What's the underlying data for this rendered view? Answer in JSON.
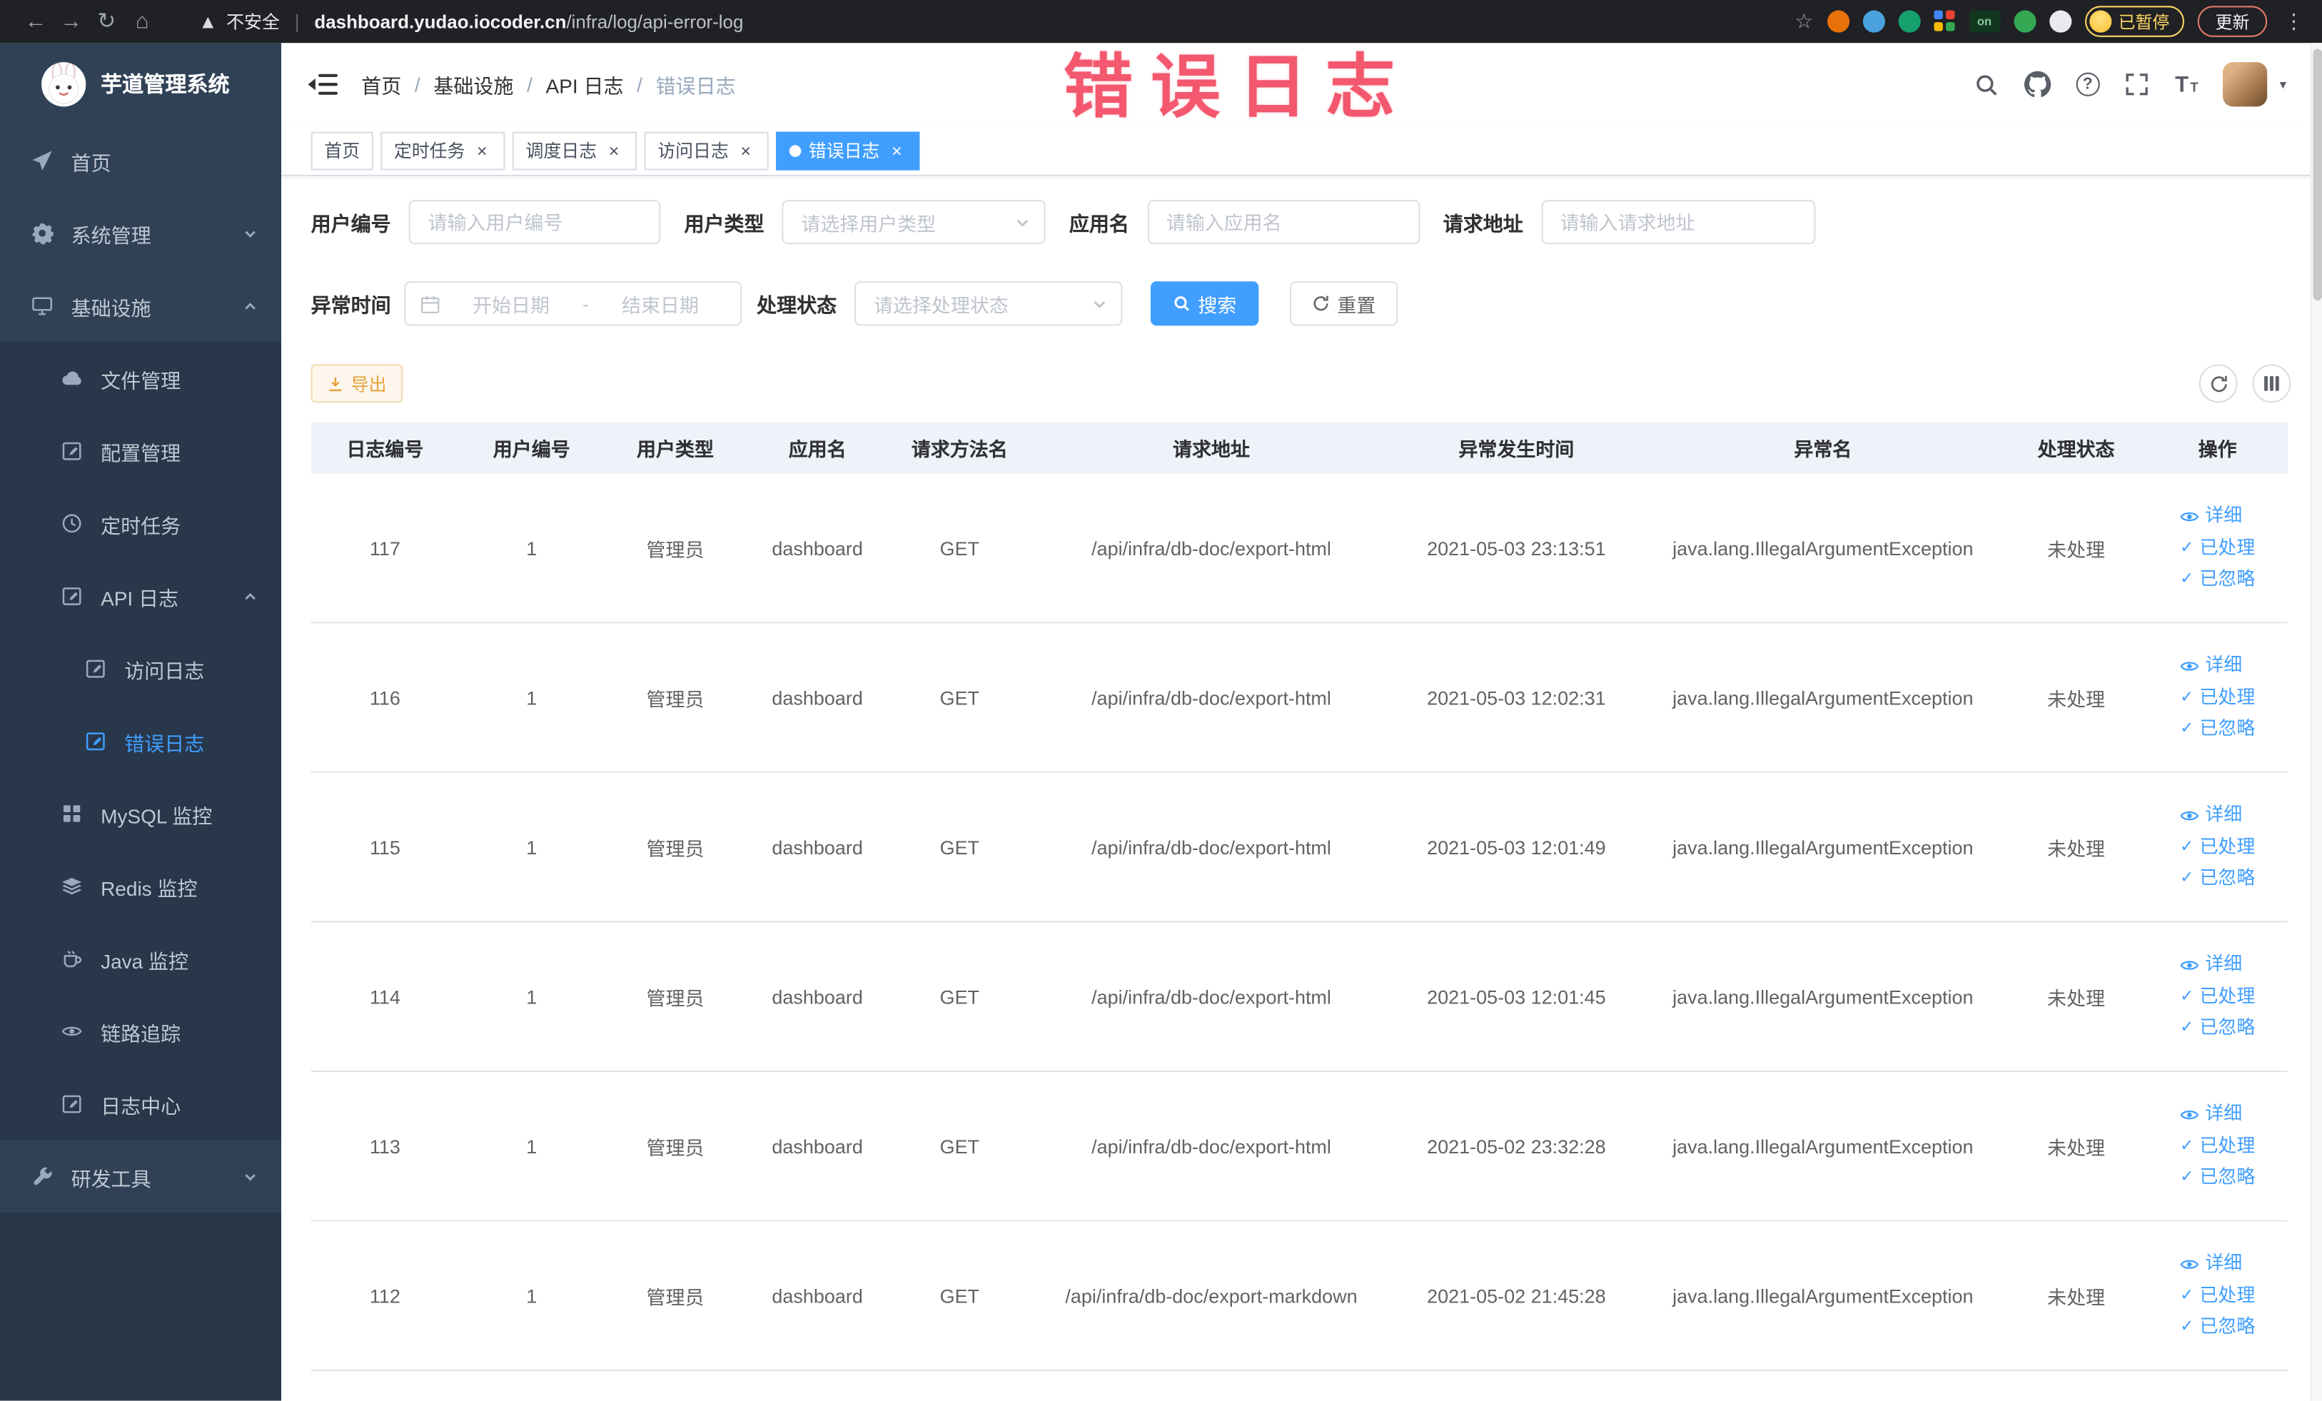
{
  "annotation": {
    "text": "错误日志"
  },
  "browser": {
    "security_label": "不安全",
    "url_domain": "dashboard.yudao.iocoder.cn",
    "url_path": "/infra/log/api-error-log",
    "extension_on_badge": "on",
    "paused_badge": "已暂停",
    "update_button": "更新"
  },
  "sidebar": {
    "logo_title": "芋道管理系统",
    "items": {
      "home": "首页",
      "system": "系统管理",
      "infra": "基础设施",
      "file": "文件管理",
      "config": "配置管理",
      "job": "定时任务",
      "apilog": "API 日志",
      "accesslog": "访问日志",
      "errorlog": "错误日志",
      "mysql": "MySQL 监控",
      "redis": "Redis 监控",
      "java": "Java 监控",
      "trace": "链路追踪",
      "logcenter": "日志中心",
      "devtools": "研发工具"
    }
  },
  "header": {
    "breadcrumb": [
      "首页",
      "基础设施",
      "API 日志",
      "错误日志"
    ]
  },
  "tabs": {
    "home": "首页",
    "job": "定时任务",
    "joblog": "调度日志",
    "accesslog": "访问日志",
    "errorlog": "错误日志"
  },
  "filters": {
    "user_id": {
      "label": "用户编号",
      "placeholder": "请输入用户编号"
    },
    "user_type": {
      "label": "用户类型",
      "placeholder": "请选择用户类型"
    },
    "app_name": {
      "label": "应用名",
      "placeholder": "请输入应用名"
    },
    "request_url": {
      "label": "请求地址",
      "placeholder": "请输入请求地址"
    },
    "exception_time": {
      "label": "异常时间",
      "start_placeholder": "开始日期",
      "separator": "-",
      "end_placeholder": "结束日期"
    },
    "process_status": {
      "label": "处理状态",
      "placeholder": "请选择处理状态"
    },
    "search_button": "搜索",
    "reset_button": "重置"
  },
  "toolbar": {
    "export_button": "导出"
  },
  "table": {
    "columns": [
      "日志编号",
      "用户编号",
      "用户类型",
      "应用名",
      "请求方法名",
      "请求地址",
      "异常发生时间",
      "异常名",
      "处理状态",
      "操作"
    ],
    "actions": {
      "detail": "详细",
      "processed": "已处理",
      "ignored": "已忽略"
    },
    "rows": [
      {
        "id": "117",
        "user_id": "1",
        "user_type": "管理员",
        "app": "dashboard",
        "method": "GET",
        "url": "/api/infra/db-doc/export-html",
        "time": "2021-05-03 23:13:51",
        "exception": "java.lang.IllegalArgumentException",
        "status": "未处理"
      },
      {
        "id": "116",
        "user_id": "1",
        "user_type": "管理员",
        "app": "dashboard",
        "method": "GET",
        "url": "/api/infra/db-doc/export-html",
        "time": "2021-05-03 12:02:31",
        "exception": "java.lang.IllegalArgumentException",
        "status": "未处理"
      },
      {
        "id": "115",
        "user_id": "1",
        "user_type": "管理员",
        "app": "dashboard",
        "method": "GET",
        "url": "/api/infra/db-doc/export-html",
        "time": "2021-05-03 12:01:49",
        "exception": "java.lang.IllegalArgumentException",
        "status": "未处理"
      },
      {
        "id": "114",
        "user_id": "1",
        "user_type": "管理员",
        "app": "dashboard",
        "method": "GET",
        "url": "/api/infra/db-doc/export-html",
        "time": "2021-05-03 12:01:45",
        "exception": "java.lang.IllegalArgumentException",
        "status": "未处理"
      },
      {
        "id": "113",
        "user_id": "1",
        "user_type": "管理员",
        "app": "dashboard",
        "method": "GET",
        "url": "/api/infra/db-doc/export-html",
        "time": "2021-05-02 23:32:28",
        "exception": "java.lang.IllegalArgumentException",
        "status": "未处理"
      },
      {
        "id": "112",
        "user_id": "1",
        "user_type": "管理员",
        "app": "dashboard",
        "method": "GET",
        "url": "/api/infra/db-doc/export-markdown",
        "time": "2021-05-02 21:45:28",
        "exception": "java.lang.IllegalArgumentException",
        "status": "未处理"
      }
    ]
  }
}
